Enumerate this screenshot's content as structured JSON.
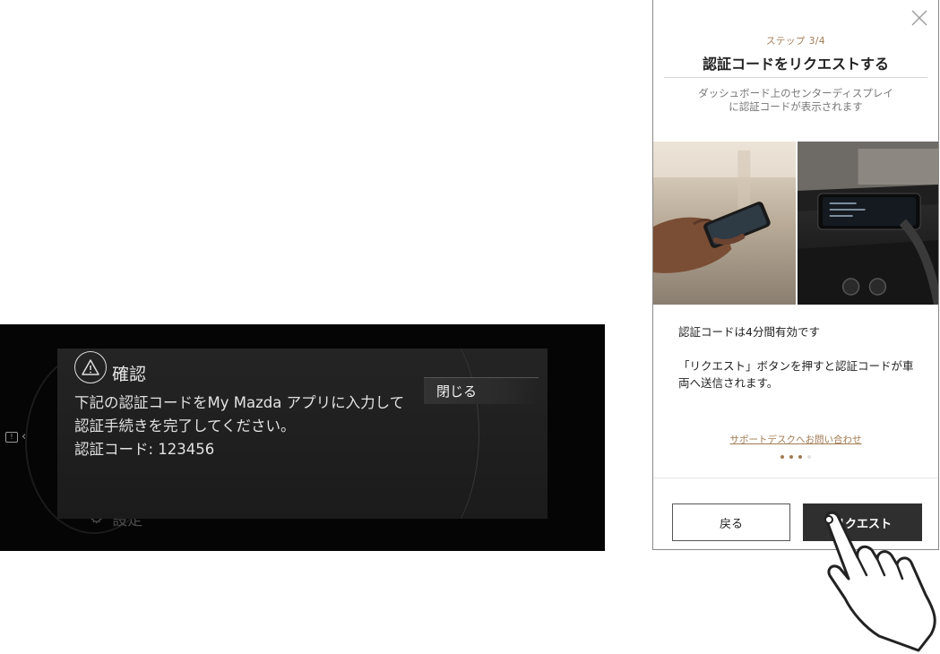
{
  "car_display": {
    "dialog": {
      "title": "確認",
      "body_lines": [
        "下記の認証コードをMy Mazda アプリに入力して",
        "認証手続きを完了してください。",
        "認証コード: 123456"
      ],
      "close_label": "閉じる"
    },
    "behind_label": "設定"
  },
  "phone_app": {
    "step": "ステップ 3/4",
    "title": "認証コードをリクエストする",
    "description": "ダッシュボード上のセンターディスプレイ\nに認証コードが表示されます",
    "valid_text": "認証コードは4分間有効です",
    "press_text": "「リクエスト」ボタンを押すと認証コードが車両へ送信されます。",
    "support_link": "サポートデスクへお問い合わせ",
    "pagination": {
      "total": 4,
      "current": 3
    },
    "back_label": "戻る",
    "request_label": "リクエスト",
    "accent_color": "#a07a52"
  }
}
